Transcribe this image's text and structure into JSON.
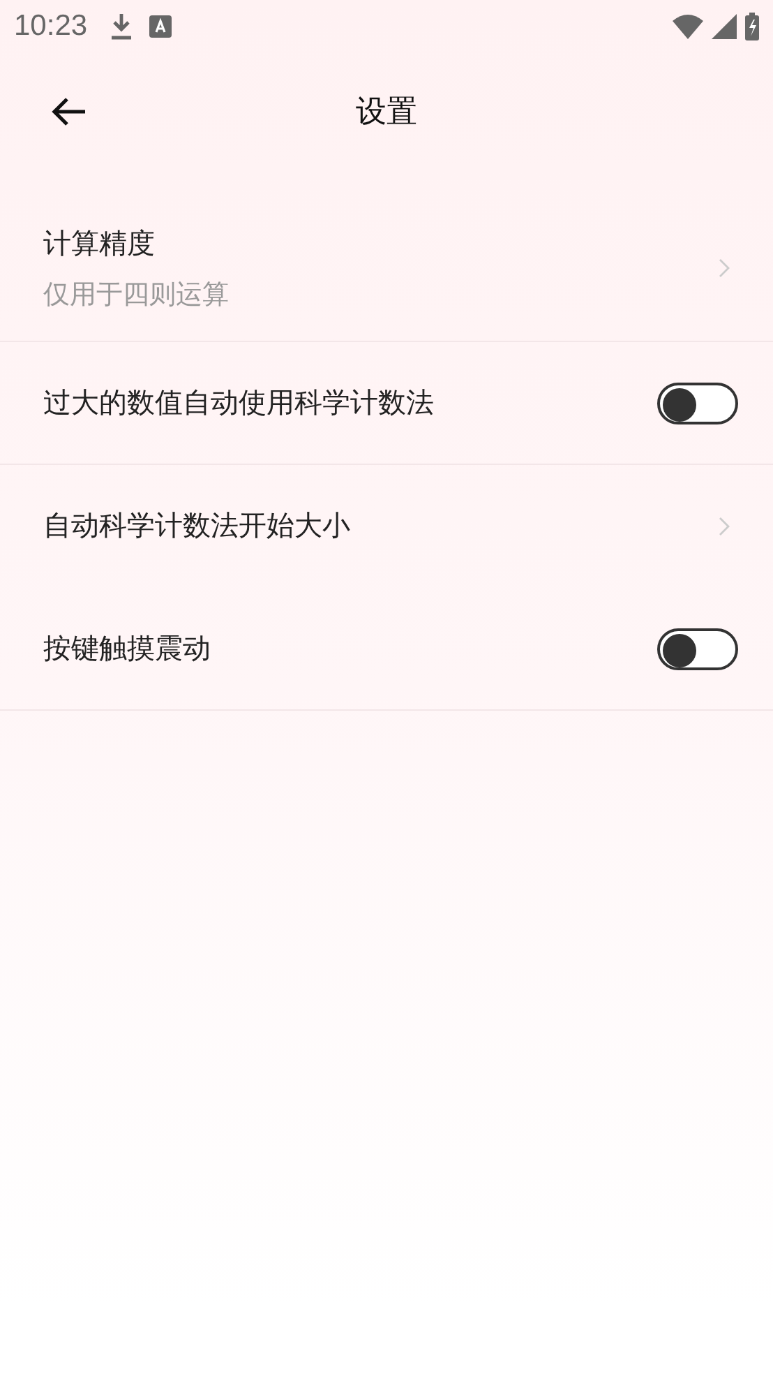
{
  "status_bar": {
    "time": "10:23"
  },
  "app_bar": {
    "title": "设置"
  },
  "items": [
    {
      "kind": "nav",
      "title": "计算精度",
      "subtitle": "仅用于四则运算",
      "divider": true
    },
    {
      "kind": "switch",
      "title": "过大的数值自动使用科学计数法",
      "on": false,
      "divider": true
    },
    {
      "kind": "nav",
      "title": "自动科学计数法开始大小",
      "divider": false
    },
    {
      "kind": "switch",
      "title": "按键触摸震动",
      "on": false,
      "divider": true
    }
  ]
}
